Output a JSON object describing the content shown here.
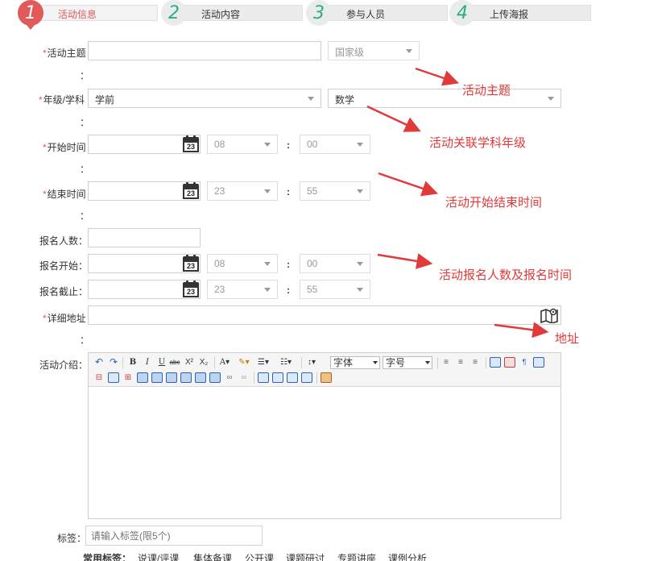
{
  "steps": [
    {
      "num": "1",
      "label": "活动信息"
    },
    {
      "num": "2",
      "label": "活动内容"
    },
    {
      "num": "3",
      "label": "参与人员"
    },
    {
      "num": "4",
      "label": "上传海报"
    }
  ],
  "form": {
    "required_mark": "*",
    "colon": "：",
    "time_colon": ":",
    "theme": {
      "label": "活动主题",
      "value": "",
      "level": "国家级"
    },
    "grade": {
      "label": "年级/学科",
      "grade_value": "学前",
      "subject_value": "数学"
    },
    "start": {
      "label": "开始时间",
      "hour": "08",
      "minute": "00"
    },
    "end": {
      "label": "结束时间",
      "hour": "23",
      "minute": "55"
    },
    "quota": {
      "label": "报名人数："
    },
    "reg_start": {
      "label": "报名开始：",
      "hour": "08",
      "minute": "00"
    },
    "reg_end": {
      "label": "报名截止：",
      "hour": "23",
      "minute": "55"
    },
    "address": {
      "label": "详细地址"
    },
    "intro": {
      "label": "活动介绍："
    },
    "tags": {
      "label": "标签：",
      "placeholder": "请输入标签(限5个)"
    },
    "common_tags": {
      "label": "常用标签：",
      "items": [
        "说课/评课",
        "集体备课",
        "公开课",
        "课题研讨",
        "专题讲座",
        "课例分析"
      ]
    }
  },
  "calendar_day": "23",
  "editor": {
    "font_family": "字体",
    "font_size": "字号"
  },
  "annotations": {
    "theme": "活动主题",
    "grade": "活动关联学科年级",
    "time": "活动开始结束时间",
    "reg": "活动报名人数及报名时间",
    "address": "地址"
  },
  "colors": {
    "accent": "#e05a5a",
    "step_number": "#2eab8c",
    "annotation": "#e03a3a"
  }
}
